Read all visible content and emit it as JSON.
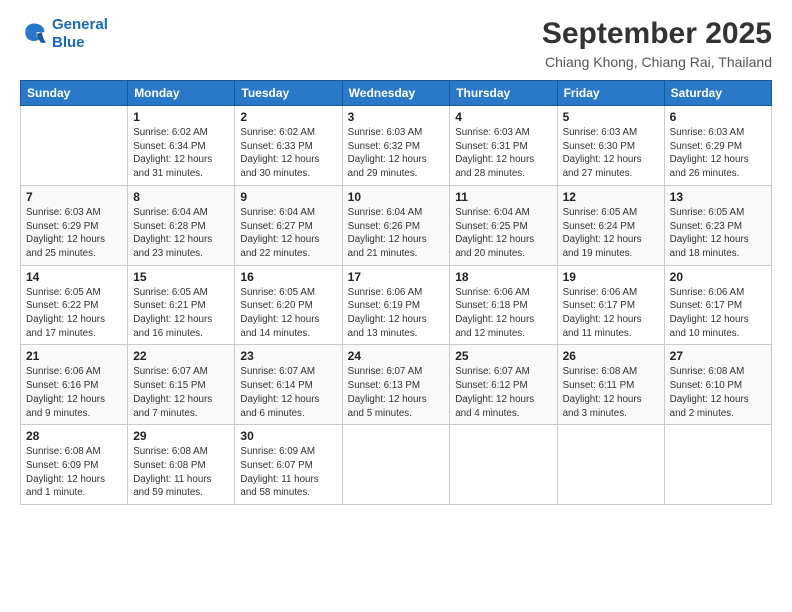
{
  "header": {
    "logo_line1": "General",
    "logo_line2": "Blue",
    "main_title": "September 2025",
    "subtitle": "Chiang Khong, Chiang Rai, Thailand"
  },
  "columns": [
    "Sunday",
    "Monday",
    "Tuesday",
    "Wednesday",
    "Thursday",
    "Friday",
    "Saturday"
  ],
  "weeks": [
    [
      {
        "day": "",
        "info": ""
      },
      {
        "day": "1",
        "info": "Sunrise: 6:02 AM\nSunset: 6:34 PM\nDaylight: 12 hours\nand 31 minutes."
      },
      {
        "day": "2",
        "info": "Sunrise: 6:02 AM\nSunset: 6:33 PM\nDaylight: 12 hours\nand 30 minutes."
      },
      {
        "day": "3",
        "info": "Sunrise: 6:03 AM\nSunset: 6:32 PM\nDaylight: 12 hours\nand 29 minutes."
      },
      {
        "day": "4",
        "info": "Sunrise: 6:03 AM\nSunset: 6:31 PM\nDaylight: 12 hours\nand 28 minutes."
      },
      {
        "day": "5",
        "info": "Sunrise: 6:03 AM\nSunset: 6:30 PM\nDaylight: 12 hours\nand 27 minutes."
      },
      {
        "day": "6",
        "info": "Sunrise: 6:03 AM\nSunset: 6:29 PM\nDaylight: 12 hours\nand 26 minutes."
      }
    ],
    [
      {
        "day": "7",
        "info": "Sunrise: 6:03 AM\nSunset: 6:29 PM\nDaylight: 12 hours\nand 25 minutes."
      },
      {
        "day": "8",
        "info": "Sunrise: 6:04 AM\nSunset: 6:28 PM\nDaylight: 12 hours\nand 23 minutes."
      },
      {
        "day": "9",
        "info": "Sunrise: 6:04 AM\nSunset: 6:27 PM\nDaylight: 12 hours\nand 22 minutes."
      },
      {
        "day": "10",
        "info": "Sunrise: 6:04 AM\nSunset: 6:26 PM\nDaylight: 12 hours\nand 21 minutes."
      },
      {
        "day": "11",
        "info": "Sunrise: 6:04 AM\nSunset: 6:25 PM\nDaylight: 12 hours\nand 20 minutes."
      },
      {
        "day": "12",
        "info": "Sunrise: 6:05 AM\nSunset: 6:24 PM\nDaylight: 12 hours\nand 19 minutes."
      },
      {
        "day": "13",
        "info": "Sunrise: 6:05 AM\nSunset: 6:23 PM\nDaylight: 12 hours\nand 18 minutes."
      }
    ],
    [
      {
        "day": "14",
        "info": "Sunrise: 6:05 AM\nSunset: 6:22 PM\nDaylight: 12 hours\nand 17 minutes."
      },
      {
        "day": "15",
        "info": "Sunrise: 6:05 AM\nSunset: 6:21 PM\nDaylight: 12 hours\nand 16 minutes."
      },
      {
        "day": "16",
        "info": "Sunrise: 6:05 AM\nSunset: 6:20 PM\nDaylight: 12 hours\nand 14 minutes."
      },
      {
        "day": "17",
        "info": "Sunrise: 6:06 AM\nSunset: 6:19 PM\nDaylight: 12 hours\nand 13 minutes."
      },
      {
        "day": "18",
        "info": "Sunrise: 6:06 AM\nSunset: 6:18 PM\nDaylight: 12 hours\nand 12 minutes."
      },
      {
        "day": "19",
        "info": "Sunrise: 6:06 AM\nSunset: 6:17 PM\nDaylight: 12 hours\nand 11 minutes."
      },
      {
        "day": "20",
        "info": "Sunrise: 6:06 AM\nSunset: 6:17 PM\nDaylight: 12 hours\nand 10 minutes."
      }
    ],
    [
      {
        "day": "21",
        "info": "Sunrise: 6:06 AM\nSunset: 6:16 PM\nDaylight: 12 hours\nand 9 minutes."
      },
      {
        "day": "22",
        "info": "Sunrise: 6:07 AM\nSunset: 6:15 PM\nDaylight: 12 hours\nand 7 minutes."
      },
      {
        "day": "23",
        "info": "Sunrise: 6:07 AM\nSunset: 6:14 PM\nDaylight: 12 hours\nand 6 minutes."
      },
      {
        "day": "24",
        "info": "Sunrise: 6:07 AM\nSunset: 6:13 PM\nDaylight: 12 hours\nand 5 minutes."
      },
      {
        "day": "25",
        "info": "Sunrise: 6:07 AM\nSunset: 6:12 PM\nDaylight: 12 hours\nand 4 minutes."
      },
      {
        "day": "26",
        "info": "Sunrise: 6:08 AM\nSunset: 6:11 PM\nDaylight: 12 hours\nand 3 minutes."
      },
      {
        "day": "27",
        "info": "Sunrise: 6:08 AM\nSunset: 6:10 PM\nDaylight: 12 hours\nand 2 minutes."
      }
    ],
    [
      {
        "day": "28",
        "info": "Sunrise: 6:08 AM\nSunset: 6:09 PM\nDaylight: 12 hours\nand 1 minute."
      },
      {
        "day": "29",
        "info": "Sunrise: 6:08 AM\nSunset: 6:08 PM\nDaylight: 11 hours\nand 59 minutes."
      },
      {
        "day": "30",
        "info": "Sunrise: 6:09 AM\nSunset: 6:07 PM\nDaylight: 11 hours\nand 58 minutes."
      },
      {
        "day": "",
        "info": ""
      },
      {
        "day": "",
        "info": ""
      },
      {
        "day": "",
        "info": ""
      },
      {
        "day": "",
        "info": ""
      }
    ]
  ]
}
